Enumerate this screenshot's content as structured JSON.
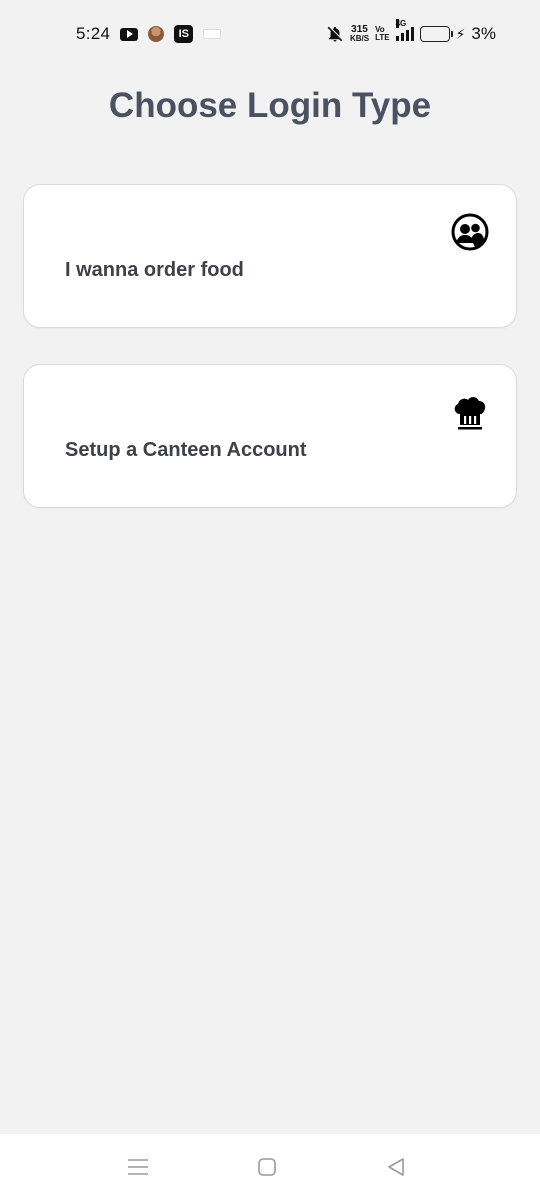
{
  "status_bar": {
    "time": "5:24",
    "app_icons": [
      "youtube-icon",
      "person-icon",
      "is-app-icon",
      "mini-app-icon"
    ],
    "notification_icon": "bell-off-icon",
    "speed_value": "315",
    "speed_unit": "KB/S",
    "volte_top": "Vo",
    "volte_bottom": "LTE",
    "network": "4G",
    "battery_percent": "3%",
    "battery_level": 0.03,
    "charging_glyph": "⚡"
  },
  "page": {
    "title": "Choose Login Type"
  },
  "options": [
    {
      "label": "I wanna order food",
      "icon": "customer-icon"
    },
    {
      "label": "Setup a Canteen Account",
      "icon": "chef-hat-icon"
    }
  ],
  "nav_bar": {
    "buttons": [
      "menu-icon",
      "home-icon",
      "back-icon"
    ]
  },
  "colors": {
    "background": "#f2f2f2",
    "card": "#ffffff",
    "title": "#4a5160",
    "label": "#3d4149",
    "battery": "#e0a400"
  }
}
